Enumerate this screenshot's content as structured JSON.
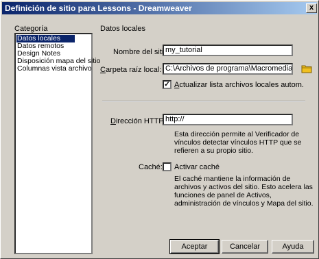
{
  "window": {
    "title": "Definición de sitio para Lessons - Dreamweaver",
    "close_label": "x"
  },
  "sidebar": {
    "heading": "Categoría",
    "items": [
      {
        "label": "Datos locales"
      },
      {
        "label": "Datos remotos"
      },
      {
        "label": "Design Notes"
      },
      {
        "label": "Disposición mapa del sitio"
      },
      {
        "label": "Columnas vista archivo"
      }
    ],
    "selected_index": 0
  },
  "panel": {
    "heading": "Datos locales",
    "site_name": {
      "label": "Nombre del sitio:",
      "value": "my_tutorial"
    },
    "local_root": {
      "label_first": "C",
      "label_rest": "arpeta raíz local:",
      "value": "C:\\Archivos de programa\\Macromedia\\Dre"
    },
    "refresh": {
      "label_first": "A",
      "label_rest": "ctualizar lista archivos locales autom.",
      "checked": true,
      "mark": "✓"
    },
    "http": {
      "label_first": "D",
      "label_rest": "irección HTTP:",
      "value": "http://"
    },
    "http_desc": [
      "Esta dirección permite al Verificador de",
      "vínculos detectar vínculos HTTP que se",
      "refieren a su propio sitio."
    ],
    "cache": {
      "label": "Caché:",
      "checkbox_label": "Activar caché",
      "checked": false
    },
    "cache_desc": [
      "El caché mantiene la información de",
      "archivos y activos del sitio. Esto acelera las",
      "funciones de panel de Activos,",
      "administración de vínculos y Mapa del sitio."
    ]
  },
  "buttons": {
    "ok": "Aceptar",
    "cancel": "Cancelar",
    "help": "Ayuda"
  },
  "colors": {
    "title_start": "#0a246a",
    "title_end": "#a6caf0",
    "selection": "#0a246a",
    "face": "#d4d0c8",
    "folder": "#f0c020"
  },
  "icons": {
    "browse": "folder-icon"
  }
}
